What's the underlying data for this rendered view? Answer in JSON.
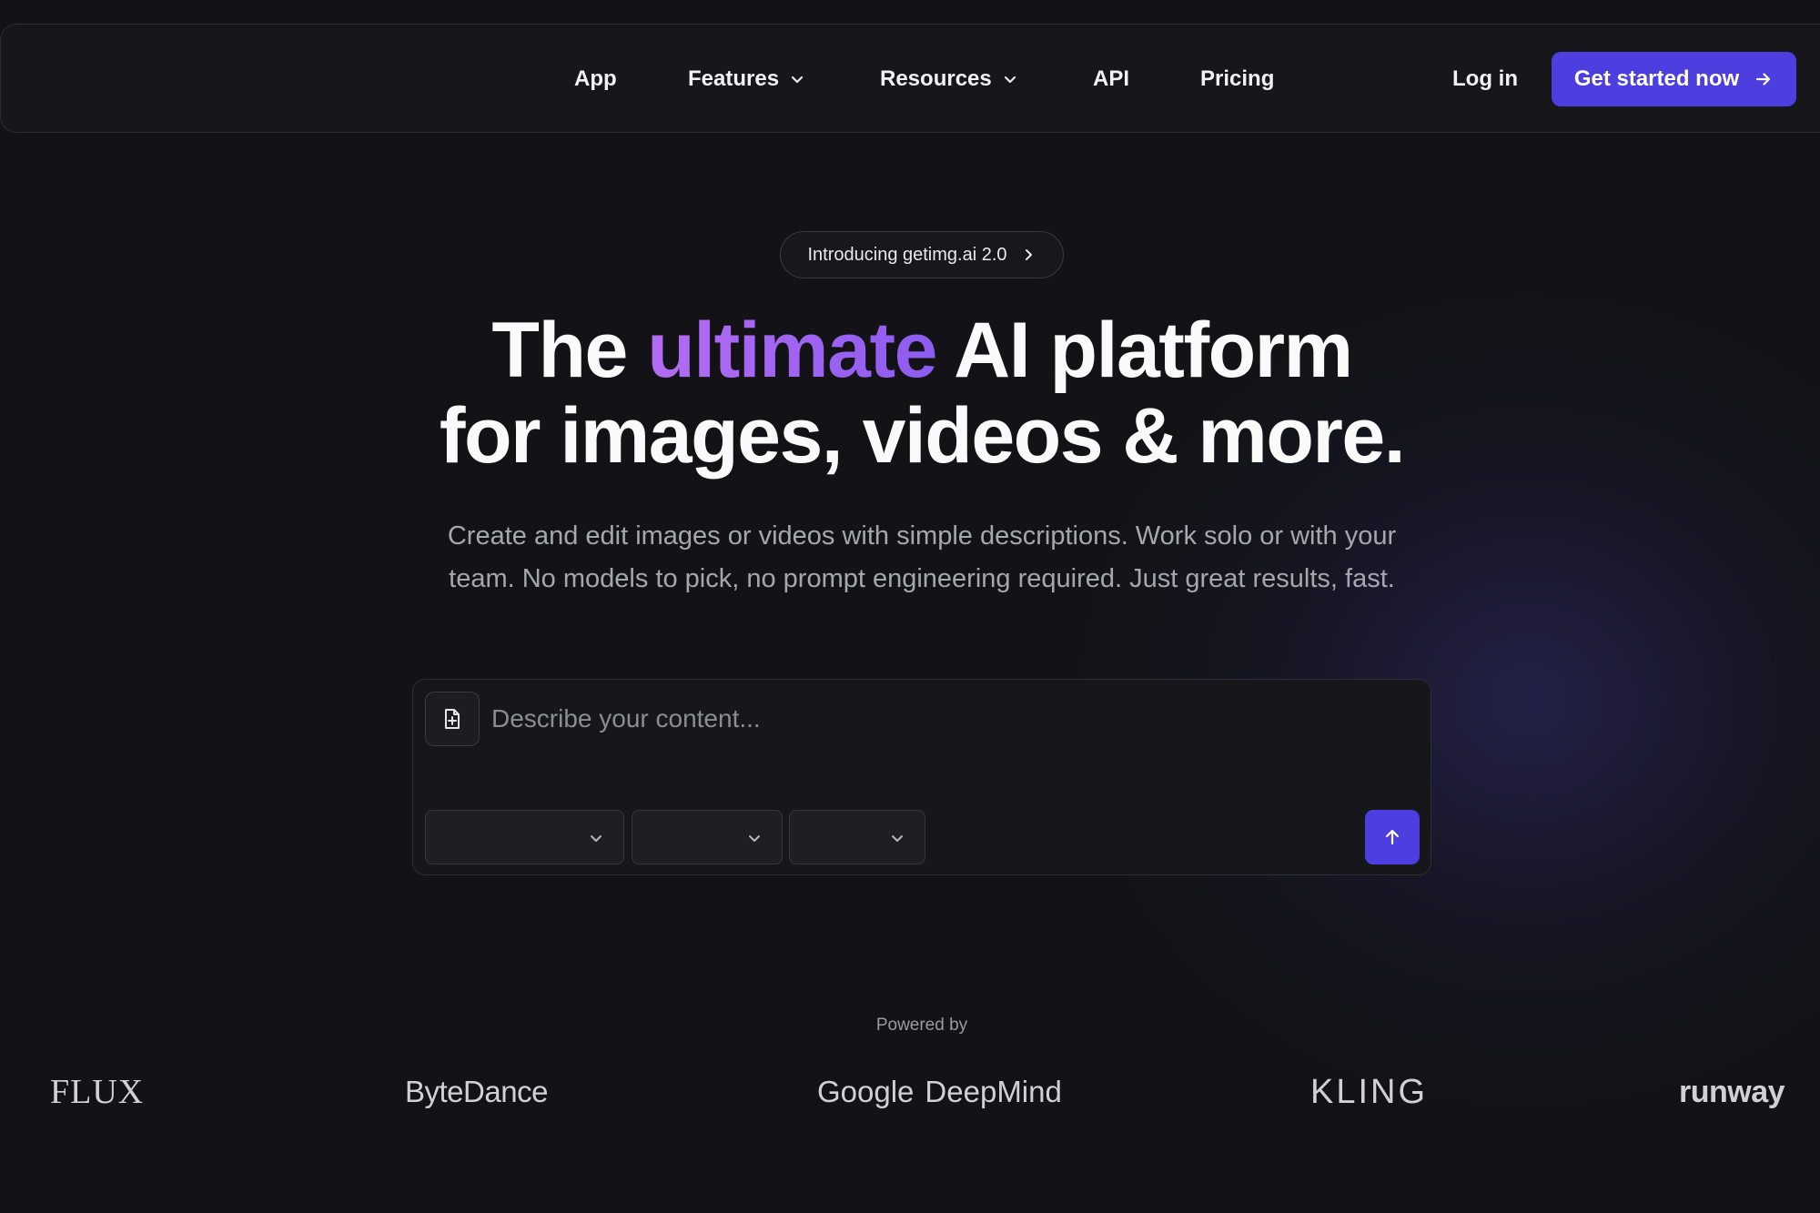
{
  "nav": {
    "items": [
      {
        "label": "App",
        "has_dropdown": false
      },
      {
        "label": "Features",
        "has_dropdown": true
      },
      {
        "label": "Resources",
        "has_dropdown": true
      },
      {
        "label": "API",
        "has_dropdown": false
      },
      {
        "label": "Pricing",
        "has_dropdown": false
      }
    ],
    "login_label": "Log in",
    "cta_label": "Get started now"
  },
  "hero": {
    "announcement": "Introducing getimg.ai 2.0",
    "headline_before": "The ",
    "headline_accent": "ultimate",
    "headline_after": " AI platform",
    "headline_line2": "for images, videos & more.",
    "subheading": "Create and edit images or videos with simple descriptions. Work solo or with your team. No models to pick, no prompt engineering required. Just great results, fast."
  },
  "prompt": {
    "placeholder": "Describe your content...",
    "value": "",
    "selects": [
      {
        "value": ""
      },
      {
        "value": ""
      },
      {
        "value": ""
      }
    ]
  },
  "powered_by": {
    "label": "Powered by",
    "logos": {
      "flux": "FLUX",
      "bytedance": "ByteDance",
      "google": "Google",
      "deepmind": "DeepMind",
      "kling": "KLING",
      "runway": "runway"
    }
  },
  "colors": {
    "background": "#131317",
    "accent": "#4d3ee0",
    "headline_gradient_start": "#b36cf2",
    "headline_gradient_end": "#8d5cf0"
  },
  "icons": {
    "nav_dropdown": "chevron-down-icon",
    "cta": "arrow-right-icon",
    "announcement": "chevron-right-icon",
    "attach": "file-add-icon",
    "select": "chevron-down-icon",
    "send": "arrow-up-icon"
  }
}
